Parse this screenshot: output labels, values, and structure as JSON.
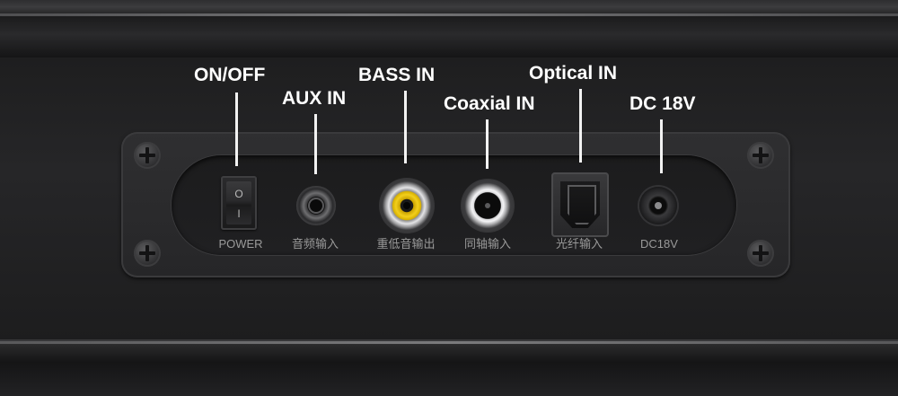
{
  "callouts": {
    "on_off": "ON/OFF",
    "aux_in": "AUX IN",
    "bass_in": "BASS IN",
    "coaxial_in": "Coaxial IN",
    "optical_in": "Optical IN",
    "dc_18v": "DC 18V"
  },
  "switch_marks": {
    "on": "I",
    "off": "O"
  },
  "port_labels": {
    "power": "POWER",
    "aux": "音频输入",
    "bass": "重低音输出",
    "coaxial": "同轴输入",
    "optical": "光纤输入",
    "dc": "DC18V"
  },
  "colors": {
    "callout_text": "#ffffff",
    "rca_ring": "#f2cf1c",
    "panel": "#262628",
    "port_label": "#9a9a9a"
  },
  "icons": [
    "screw-icon",
    "power-switch",
    "aux-jack",
    "rca-jack",
    "coaxial-jack",
    "optical-port",
    "dc-jack"
  ]
}
